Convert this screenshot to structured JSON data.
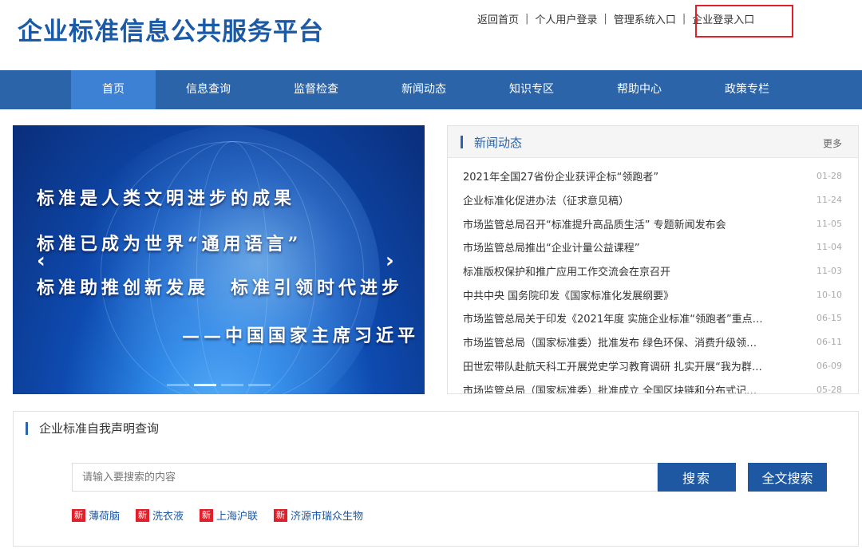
{
  "header": {
    "logo": "企业标准信息公共服务平台",
    "links": [
      "返回首页",
      "个人用户登录",
      "管理系统入口",
      "企业登录入口"
    ],
    "separator": "|"
  },
  "nav": {
    "items": [
      "首页",
      "信息查询",
      "监督检查",
      "新闻动态",
      "知识专区",
      "帮助中心",
      "政策专栏"
    ],
    "active_index": 0
  },
  "banner": {
    "lines": [
      "标准是人类文明进步的成果",
      "标准已成为世界“通用语言”",
      "标准助推创新发展　标准引领时代进步",
      "——中国国家主席习近平"
    ],
    "prev_arrow": "‹",
    "next_arrow": "›",
    "slide_count": 4,
    "active_slide": 1
  },
  "news": {
    "title": "新闻动态",
    "more": "更多",
    "items": [
      {
        "title": "2021年全国27省份企业获评企标“领跑者”",
        "date": "01-28"
      },
      {
        "title": "企业标准化促进办法（征求意见稿）",
        "date": "11-24"
      },
      {
        "title": "市场监管总局召开“标准提升高品质生活” 专题新闻发布会",
        "date": "11-05"
      },
      {
        "title": "市场监管总局推出“企业计量公益课程”",
        "date": "11-04"
      },
      {
        "title": "标准版权保护和推广应用工作交流会在京召开",
        "date": "11-03"
      },
      {
        "title": "中共中央 国务院印发《国家标准化发展纲要》",
        "date": "10-10"
      },
      {
        "title": "市场监管总局关于印发《2021年度 实施企业标准“领跑者”重点…",
        "date": "06-15"
      },
      {
        "title": "市场监管总局（国家标准委）批准发布 绿色环保、消费升级领…",
        "date": "06-11"
      },
      {
        "title": "田世宏带队赴航天科工开展党史学习教育调研 扎实开展“我为群…",
        "date": "06-09"
      },
      {
        "title": "市场监管总局（国家标准委）批准成立 全国区块链和分布式记…",
        "date": "05-28"
      }
    ]
  },
  "search": {
    "title": "企业标准自我声明查询",
    "placeholder": "请输入要搜索的内容",
    "search_button": "搜索",
    "fulltext_button": "全文搜索",
    "badge": "新",
    "hot": [
      "薄荷脑",
      "洗衣液",
      "上海沪联",
      "济源市瑞众生物"
    ]
  },
  "colors": {
    "brand": "#2b64a8",
    "nav_active": "#3d81d4",
    "highlight_box": "#e0202b",
    "button": "#1e58a2"
  }
}
